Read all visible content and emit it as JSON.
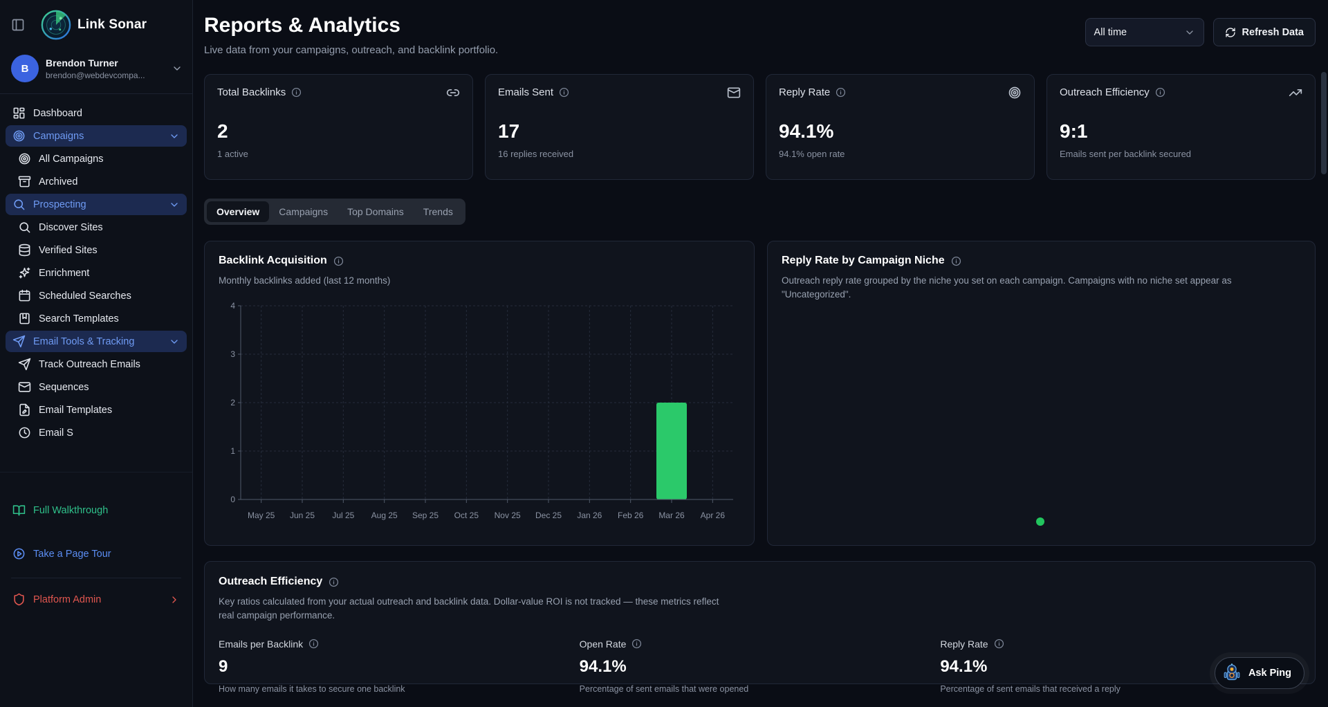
{
  "sidebar": {
    "brand": "Link Sonar",
    "user": {
      "initial": "B",
      "name": "Brendon Turner",
      "email": "brendon@webdevcompa..."
    },
    "nav": [
      {
        "label": "Dashboard",
        "icon": "dashboard-icon"
      },
      {
        "label": "Campaigns",
        "icon": "target-icon"
      },
      {
        "label": "All Campaigns",
        "icon": "target-icon"
      },
      {
        "label": "Archived",
        "icon": "archive-icon"
      },
      {
        "label": "Prospecting",
        "icon": "search-icon"
      },
      {
        "label": "Discover Sites",
        "icon": "search-icon"
      },
      {
        "label": "Verified Sites",
        "icon": "database-icon"
      },
      {
        "label": "Enrichment",
        "icon": "sparkles-icon"
      },
      {
        "label": "Scheduled Searches",
        "icon": "calendar-icon"
      },
      {
        "label": "Search Templates",
        "icon": "bookmark-icon"
      },
      {
        "label": "Email Tools & Tracking",
        "icon": "send-icon"
      },
      {
        "label": "Track Outreach Emails",
        "icon": "send-icon"
      },
      {
        "label": "Sequences",
        "icon": "mail-icon"
      },
      {
        "label": "Email Templates",
        "icon": "file-icon"
      },
      {
        "label": "Email S",
        "icon": "clock-icon"
      }
    ],
    "footer": [
      {
        "label": "Full Walkthrough",
        "icon": "book-open-icon",
        "color": "#2fc08a"
      },
      {
        "label": "Take a Page Tour",
        "icon": "play-circle-icon",
        "color": "#5b8df2"
      },
      {
        "label": "Platform Admin",
        "icon": "shield-icon",
        "color": "#e0564f"
      }
    ]
  },
  "header": {
    "title": "Reports & Analytics",
    "subtitle": "Live data from your campaigns, outreach, and backlink portfolio.",
    "time_filter": "All time",
    "refresh_label": "Refresh Data"
  },
  "stats": [
    {
      "label": "Total Backlinks",
      "icon": "link-icon",
      "value": "2",
      "sub": "1 active"
    },
    {
      "label": "Emails Sent",
      "icon": "mail-icon",
      "value": "17",
      "sub": "16 replies received"
    },
    {
      "label": "Reply Rate",
      "icon": "target-icon",
      "value": "94.1%",
      "sub": "94.1% open rate"
    },
    {
      "label": "Outreach Efficiency",
      "icon": "trending-up-icon",
      "value": "9:1",
      "sub": "Emails sent per backlink secured"
    }
  ],
  "tabs": [
    "Overview",
    "Campaigns",
    "Top Domains",
    "Trends"
  ],
  "charts": {
    "backlink": {
      "title": "Backlink Acquisition",
      "subtitle": "Monthly backlinks added (last 12 months)"
    },
    "niche": {
      "title": "Reply Rate by Campaign Niche",
      "description": "Outreach reply rate grouped by the niche you set on each campaign. Campaigns with no niche set appear as \"Uncategorized\"."
    }
  },
  "chart_data": {
    "type": "bar",
    "title": "Backlink Acquisition",
    "categories": [
      "May 25",
      "Jun 25",
      "Jul 25",
      "Aug 25",
      "Sep 25",
      "Oct 25",
      "Nov 25",
      "Dec 25",
      "Jan 26",
      "Feb 26",
      "Mar 26",
      "Apr 26"
    ],
    "values": [
      0,
      0,
      0,
      0,
      0,
      0,
      0,
      0,
      0,
      0,
      2,
      0
    ],
    "xlabel": "",
    "ylabel": "",
    "ylim": [
      0,
      4
    ],
    "yticks": [
      0,
      1,
      2,
      3,
      4
    ],
    "bar_color": "#2bc96a",
    "grid": true,
    "legend_position": "none"
  },
  "efficiency": {
    "title": "Outreach Efficiency",
    "description": "Key ratios calculated from your actual outreach and backlink data. Dollar-value ROI is not tracked — these metrics reflect real campaign performance.",
    "metrics": [
      {
        "label": "Emails per Backlink",
        "value": "9",
        "sub": "How many emails it takes to secure one backlink"
      },
      {
        "label": "Open Rate",
        "value": "94.1%",
        "sub": "Percentage of sent emails that were opened"
      },
      {
        "label": "Reply Rate",
        "value": "94.1%",
        "sub": "Percentage of sent emails that received a reply"
      }
    ]
  },
  "ask_ping": {
    "label": "Ask Ping"
  }
}
